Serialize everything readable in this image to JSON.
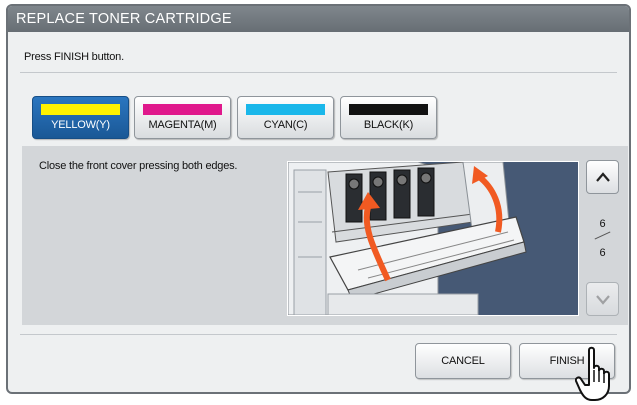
{
  "window": {
    "title": "REPLACE TONER CARTRIDGE"
  },
  "instruction": "Press FINISH button.",
  "color_tabs": [
    {
      "label": "YELLOW(Y)",
      "swatch": "#fff200",
      "active": true
    },
    {
      "label": "MAGENTA(M)",
      "swatch": "#e0188c",
      "active": false
    },
    {
      "label": "CYAN(C)",
      "swatch": "#1ab7ea",
      "active": false
    },
    {
      "label": "BLACK(K)",
      "swatch": "#111111",
      "active": false
    }
  ],
  "step": {
    "description": "Close the front cover pressing both edges.",
    "page_current": "6",
    "page_total": "6"
  },
  "buttons": {
    "cancel": "CANCEL",
    "finish": "FINISH"
  },
  "icons": {
    "scroll_up": "chevron-up-icon",
    "scroll_down": "chevron-down-icon",
    "pointer": "pointing-hand-icon"
  },
  "colors": {
    "title_bar": "#6f767c",
    "active_tab": "#1f63a8",
    "arrow": "#f15a22"
  }
}
